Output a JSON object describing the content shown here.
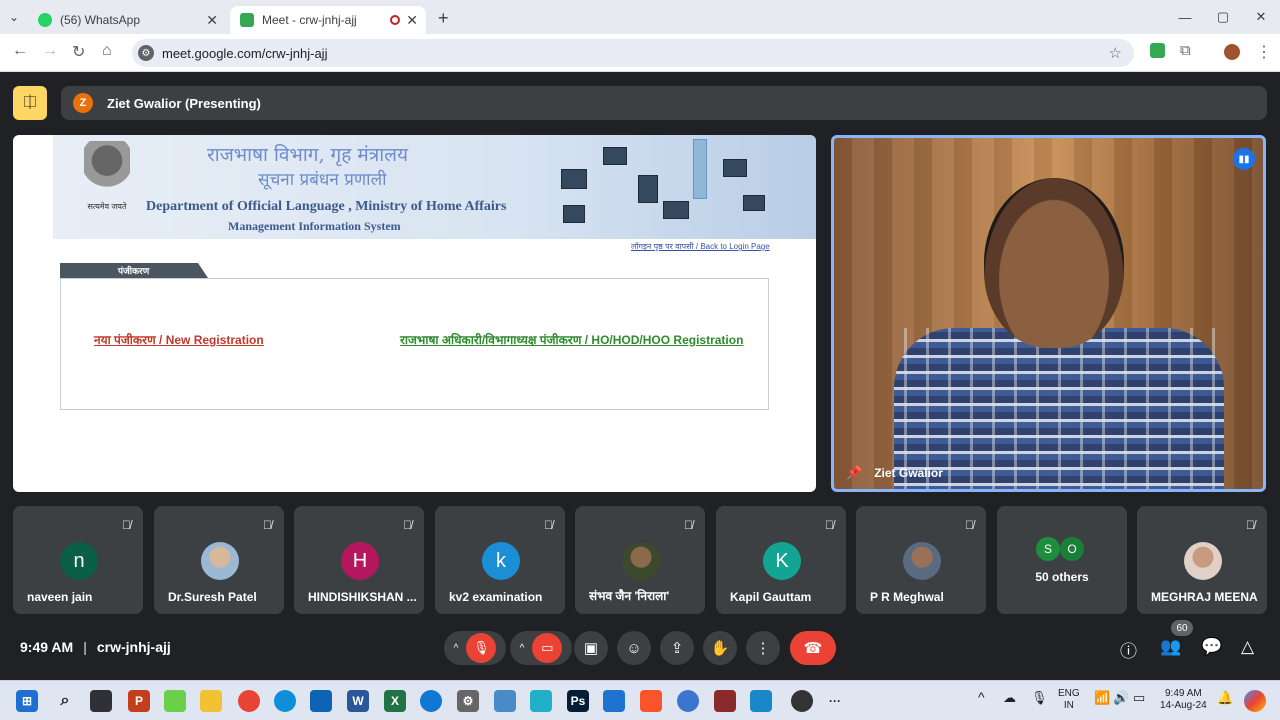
{
  "browser": {
    "tabs": [
      {
        "title": "(56) WhatsApp",
        "active": false,
        "icon": "whatsapp-icon"
      },
      {
        "title": "Meet - crw-jnhj-ajj",
        "active": true,
        "icon": "meet-icon",
        "recording": true
      }
    ],
    "url": "meet.google.com/crw-jnhj-ajj"
  },
  "meet": {
    "presenting_label": "Ziet Gwalior (Presenting)",
    "presenter_initial": "Z",
    "shared_screen": {
      "banner_hindi_1": "राजभाषा विभाग, गृह मंत्रालय",
      "banner_hindi_2": "सूचना प्रबंधन प्रणाली",
      "banner_title": "Department of Official Language , Ministry of Home Affairs",
      "banner_subtitle": "Management  Information  System",
      "emblem_text": "सत्यमेव जयते",
      "back_link": "लॉगइन पृष्ठ पर वापसी / Back to Login Page",
      "panel_tab": "पंजीकरण",
      "new_registration": "नया पंजीकरण / New Registration",
      "hod_registration": "राजभाषा अधिकारी/विभागाध्यक्ष पंजीकरण / HO/HOD/HOO Registration"
    },
    "camera_name": "Ziet Gwalior",
    "participants": [
      {
        "name": "naveen jain",
        "initial": "n",
        "color": "#0b5f46",
        "photo": false
      },
      {
        "name": "Dr.Suresh Patel",
        "initial": "",
        "color": "#9bb9d4",
        "photo": true
      },
      {
        "name": "HINDISHIKSHAN ...",
        "initial": "H",
        "color": "#b5175f",
        "photo": false
      },
      {
        "name": "kv2 examination",
        "initial": "k",
        "color": "#1a8fd6",
        "photo": false
      },
      {
        "name": "संभव जैन 'निराला'",
        "initial": "",
        "color": "#6b5a3a",
        "photo": true
      },
      {
        "name": "Kapil Gauttam",
        "initial": "K",
        "color": "#12a594",
        "photo": false
      },
      {
        "name": "P R Meghwal",
        "initial": "",
        "color": "#a58a80",
        "photo": true
      },
      {
        "name": "MEGHRAJ MEENA",
        "initial": "",
        "color": "#c9a090",
        "photo": true
      }
    ],
    "others": {
      "label": "50 others",
      "initials": [
        "S",
        "O"
      ]
    },
    "time": "9:49 AM",
    "meeting_code": "crw-jnhj-ajj",
    "people_count": "60"
  },
  "taskbar": {
    "lang": "ENG",
    "region": "IN",
    "time": "9:49 AM",
    "date": "14-Aug-24"
  }
}
